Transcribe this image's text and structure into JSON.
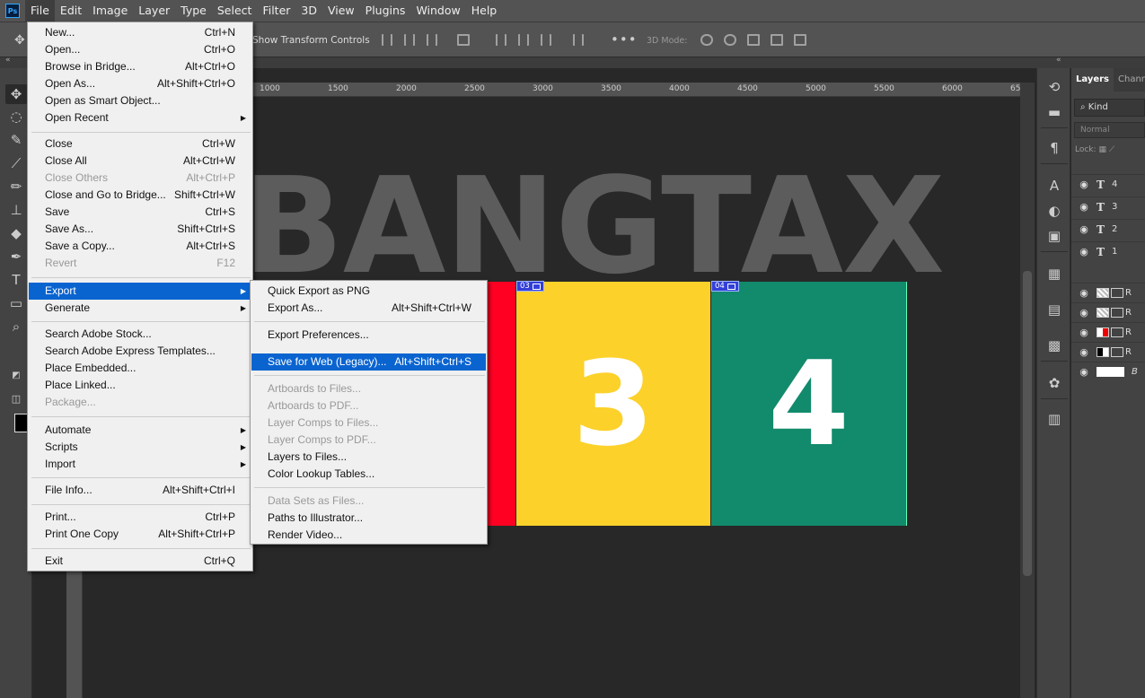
{
  "menubar": {
    "logo": "Ps",
    "items": [
      "File",
      "Edit",
      "Image",
      "Layer",
      "Type",
      "Select",
      "Filter",
      "3D",
      "View",
      "Plugins",
      "Window",
      "Help"
    ]
  },
  "options": {
    "show_transform": "Show Transform Controls",
    "more": "•••",
    "mode_3d": "3D Mode:"
  },
  "ruler": {
    "ticks": [
      "1000",
      "1500",
      "2000",
      "2500",
      "3000",
      "3500",
      "4000",
      "4500",
      "5000",
      "5500",
      "6000",
      "65"
    ]
  },
  "canvas": {
    "title": "BANGTAX",
    "artboards": [
      {
        "tag": "03",
        "number": "3",
        "color": "#fcd12a"
      },
      {
        "tag": "04",
        "number": "4",
        "color": "#128a6c"
      }
    ]
  },
  "layers": {
    "tab_layers": "Layers",
    "tab_channels": "Chann",
    "kind": "Kind",
    "blend": "Normal",
    "lock": "Lock:",
    "rows": [
      {
        "type": "text",
        "label": "4"
      },
      {
        "type": "text",
        "label": "3"
      },
      {
        "type": "text",
        "label": "2"
      },
      {
        "type": "text",
        "label": "1"
      },
      {
        "type": "image",
        "label": "R"
      },
      {
        "type": "image",
        "label": "R"
      },
      {
        "type": "image",
        "label": "R"
      },
      {
        "type": "image",
        "label": "R"
      },
      {
        "type": "image",
        "label": "B"
      }
    ]
  },
  "file_menu": {
    "items": [
      {
        "label": "New...",
        "shortcut": "Ctrl+N"
      },
      {
        "label": "Open...",
        "shortcut": "Ctrl+O"
      },
      {
        "label": "Browse in Bridge...",
        "shortcut": "Alt+Ctrl+O"
      },
      {
        "label": "Open As...",
        "shortcut": "Alt+Shift+Ctrl+O"
      },
      {
        "label": "Open as Smart Object...",
        "shortcut": ""
      },
      {
        "label": "Open Recent",
        "shortcut": ""
      },
      {
        "label": "Close",
        "shortcut": "Ctrl+W"
      },
      {
        "label": "Close All",
        "shortcut": "Alt+Ctrl+W"
      },
      {
        "label": "Close Others",
        "shortcut": "Alt+Ctrl+P"
      },
      {
        "label": "Close and Go to Bridge...",
        "shortcut": "Shift+Ctrl+W"
      },
      {
        "label": "Save",
        "shortcut": "Ctrl+S"
      },
      {
        "label": "Save As...",
        "shortcut": "Shift+Ctrl+S"
      },
      {
        "label": "Save a Copy...",
        "shortcut": "Alt+Ctrl+S"
      },
      {
        "label": "Revert",
        "shortcut": "F12"
      },
      {
        "label": "Export",
        "shortcut": ""
      },
      {
        "label": "Generate",
        "shortcut": ""
      },
      {
        "label": "Search Adobe Stock...",
        "shortcut": ""
      },
      {
        "label": "Search Adobe Express Templates...",
        "shortcut": ""
      },
      {
        "label": "Place Embedded...",
        "shortcut": ""
      },
      {
        "label": "Place Linked...",
        "shortcut": ""
      },
      {
        "label": "Package...",
        "shortcut": ""
      },
      {
        "label": "Automate",
        "shortcut": ""
      },
      {
        "label": "Scripts",
        "shortcut": ""
      },
      {
        "label": "Import",
        "shortcut": ""
      },
      {
        "label": "File Info...",
        "shortcut": "Alt+Shift+Ctrl+I"
      },
      {
        "label": "Print...",
        "shortcut": "Ctrl+P"
      },
      {
        "label": "Print One Copy",
        "shortcut": "Alt+Shift+Ctrl+P"
      },
      {
        "label": "Exit",
        "shortcut": "Ctrl+Q"
      }
    ]
  },
  "export_menu": {
    "items": [
      {
        "label": "Quick Export as PNG",
        "shortcut": ""
      },
      {
        "label": "Export As...",
        "shortcut": "Alt+Shift+Ctrl+W"
      },
      {
        "label": "Export Preferences...",
        "shortcut": ""
      },
      {
        "label": "Save for Web (Legacy)...",
        "shortcut": "Alt+Shift+Ctrl+S"
      },
      {
        "label": "Artboards to Files...",
        "shortcut": ""
      },
      {
        "label": "Artboards to PDF...",
        "shortcut": ""
      },
      {
        "label": "Layer Comps to Files...",
        "shortcut": ""
      },
      {
        "label": "Layer Comps to PDF...",
        "shortcut": ""
      },
      {
        "label": "Layers to Files...",
        "shortcut": ""
      },
      {
        "label": "Color Lookup Tables...",
        "shortcut": ""
      },
      {
        "label": "Data Sets as Files...",
        "shortcut": ""
      },
      {
        "label": "Paths to Illustrator...",
        "shortcut": ""
      },
      {
        "label": "Render Video...",
        "shortcut": ""
      }
    ]
  }
}
